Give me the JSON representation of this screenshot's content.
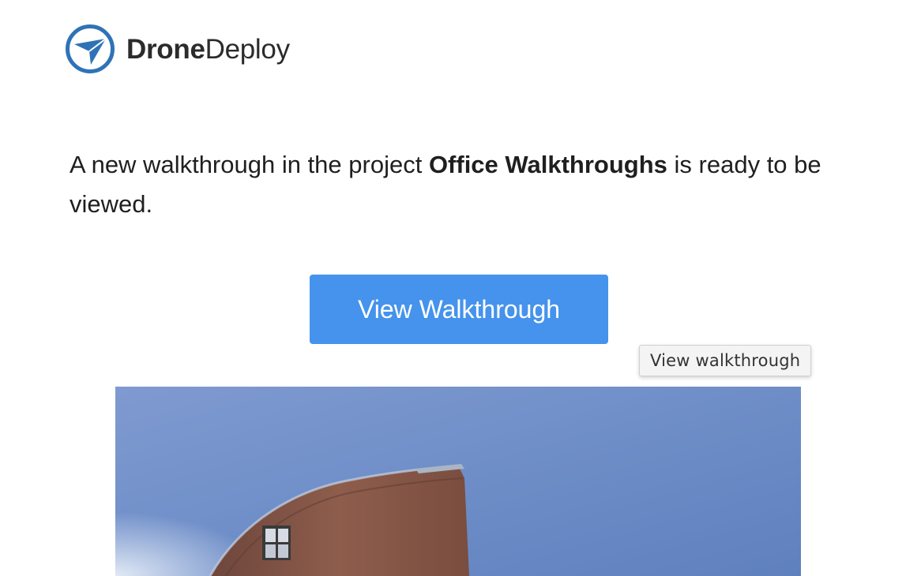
{
  "brand": {
    "name_bold": "Drone",
    "name_regular": "Deploy",
    "color": "#2f73b6",
    "icon": "dronedeploy-logo-icon"
  },
  "message": {
    "prefix": "A new walkthrough in the project ",
    "project_name": "Office Walkthroughs",
    "suffix": " is ready to be viewed."
  },
  "cta": {
    "label": "View Walkthrough",
    "color": "#4593ec"
  },
  "tooltip": {
    "text": "View walkthrough"
  },
  "preview": {
    "description_icon": "walkthrough-preview-image",
    "sky_color": "#6f8fc7",
    "building_color": "#8a5a4a"
  }
}
